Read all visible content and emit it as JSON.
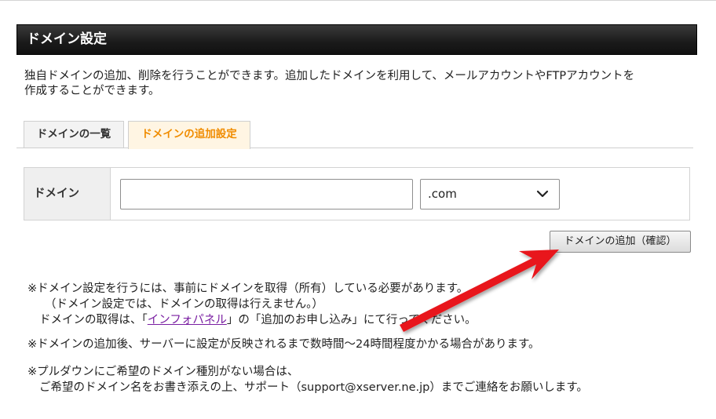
{
  "page": {
    "title": "ドメイン設定",
    "description_line1": "独自ドメインの追加、削除を行うことができます。追加したドメインを利用して、メールアカウントやFTPアカウントを",
    "description_line2": "作成することができます。"
  },
  "tabs": [
    {
      "label": "ドメインの一覧",
      "active": false
    },
    {
      "label": "ドメインの追加設定",
      "active": true
    }
  ],
  "form": {
    "domain_label": "ドメイン",
    "domain_value": "",
    "tld_selected": ".com",
    "confirm_label": "ドメインの追加（確認）"
  },
  "notes": {
    "n1_line1": "※ドメイン設定を行うには、事前にドメインを取得（所有）している必要があります。",
    "n1_line2": "（ドメイン設定では、ドメインの取得は行えません。）",
    "n1_line3_pre": "ドメインの取得は、「",
    "n1_link": "インフォパネル",
    "n1_line3_post": "」の「追加のお申し込み」にて行ってください。",
    "n2": "※ドメインの追加後、サーバーに設定が反映されるまで数時間～24時間程度かかる場合があります。",
    "n3_line1": "※プルダウンにご希望のドメイン種別がない場合は、",
    "n3_line2": "ご希望のドメイン名をお書き添えの上、サポート（support@xserver.ne.jp）までご連絡をお願いします。"
  },
  "colors": {
    "active_tab_text": "#f08c00",
    "arrow": "#e8151b",
    "link": "#7a1fa2"
  }
}
